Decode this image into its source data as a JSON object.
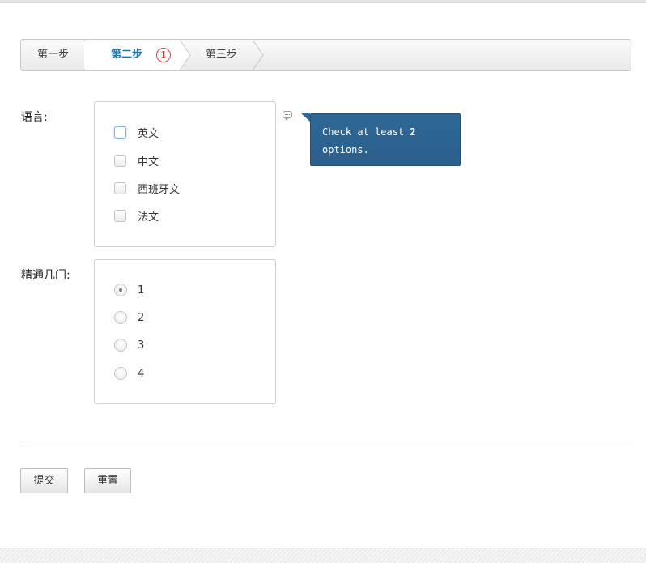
{
  "steps": [
    {
      "label": "第一步",
      "active": false
    },
    {
      "label": "第二步",
      "active": true,
      "badge": "1"
    },
    {
      "label": "第三步",
      "active": false
    }
  ],
  "form": {
    "languages": {
      "label": "语言:",
      "options": [
        {
          "label": "英文",
          "checked": false,
          "focused": true
        },
        {
          "label": "中文",
          "checked": false
        },
        {
          "label": "西班牙文",
          "checked": false
        },
        {
          "label": "法文",
          "checked": false
        }
      ],
      "tooltip": {
        "text_before": "Check at least ",
        "number": "2",
        "text_after": "options."
      }
    },
    "proficiency": {
      "label": "精通几门:",
      "options": [
        {
          "label": "1",
          "checked": true
        },
        {
          "label": "2",
          "checked": false
        },
        {
          "label": "3",
          "checked": false
        },
        {
          "label": "4",
          "checked": false
        }
      ]
    }
  },
  "buttons": {
    "submit": "提交",
    "reset": "重置"
  },
  "colors": {
    "active_step": "#1f77b0",
    "tooltip_bg": "#2e6797",
    "badge": "#c22222"
  },
  "icons": {
    "tooltip_icon": "comment-icon"
  }
}
